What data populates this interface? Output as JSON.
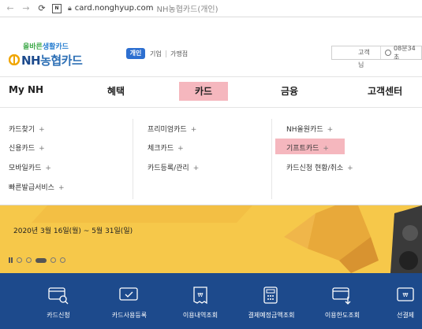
{
  "browser": {
    "host": "card.nonghyup.com",
    "title_rest": "NH농협카드(개인)",
    "favicon_text": "N"
  },
  "header": {
    "slogan_part1": "올바른",
    "slogan_part2": "생활카드",
    "logo_nh": "NH",
    "logo_card": "농협카드",
    "persona_active": "개인",
    "persona_biz": "기업",
    "persona_merchant": "가맹점",
    "cs_label": "고객님",
    "cs_hours": "08분34초"
  },
  "gnb": {
    "items": [
      {
        "label": "My NH"
      },
      {
        "label": "혜택"
      },
      {
        "label": "카드"
      },
      {
        "label": "금융"
      },
      {
        "label": "고객센터"
      }
    ]
  },
  "dropdown": {
    "col1": [
      "카드찾기",
      "신용카드",
      "모바일카드",
      "빠른발급서비스"
    ],
    "col2": [
      "프리미엄카드",
      "체크카드",
      "카드등록/관리"
    ],
    "col3": [
      "NH올원카드",
      "기프트카드",
      "카드신청 현황/취소"
    ],
    "plus": "+"
  },
  "banner": {
    "date": "2020년 3월 16일(월) ~ 5월 31일(일)"
  },
  "quickmenu": {
    "items": [
      {
        "label": "카드신청",
        "icon": "card-search-icon"
      },
      {
        "label": "카드사용등록",
        "icon": "card-check-icon"
      },
      {
        "label": "이용내역조회",
        "icon": "receipt-icon"
      },
      {
        "label": "결제예정금액조회",
        "icon": "calculator-icon"
      },
      {
        "label": "이용한도조회",
        "icon": "card-limit-icon"
      },
      {
        "label": "선결제",
        "icon": "prepay-icon"
      }
    ]
  },
  "colors": {
    "highlight": "#f5b7be",
    "brand_blue": "#1d4a8c",
    "banner_yellow": "#f6c84a"
  }
}
